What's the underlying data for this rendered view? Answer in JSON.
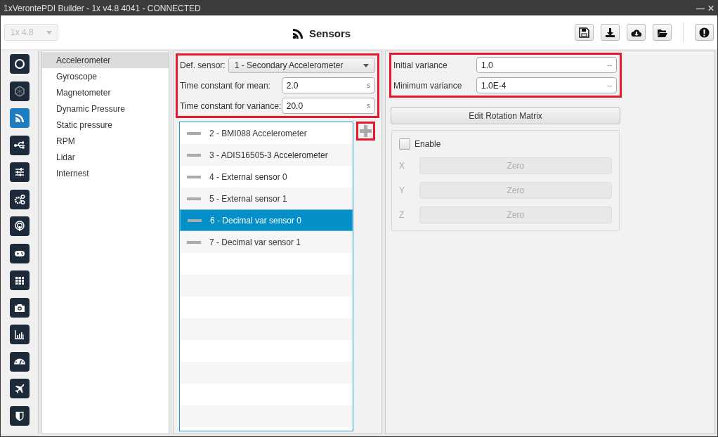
{
  "window": {
    "title": "1xVerontePDI Builder - 1x v4.8 4041 - CONNECTED",
    "controls": [
      "—",
      "✕"
    ]
  },
  "header": {
    "version_select": "1x 4.8",
    "title": "Sensors",
    "toolbar": [
      {
        "kind": "save"
      },
      {
        "kind": "download"
      },
      {
        "kind": "cloud"
      },
      {
        "kind": "folder"
      },
      {
        "kind": "alert"
      }
    ]
  },
  "rail": [
    {
      "selected": false
    },
    {
      "selected": false
    },
    {
      "selected": true
    },
    {
      "selected": false
    },
    {
      "selected": false
    },
    {
      "selected": false
    },
    {
      "selected": false
    },
    {
      "selected": false
    },
    {
      "selected": false
    },
    {
      "selected": false
    },
    {
      "selected": false
    },
    {
      "selected": false
    },
    {
      "selected": false
    },
    {
      "selected": false
    }
  ],
  "menu": [
    {
      "label": "Accelerometer",
      "selected": true
    },
    {
      "label": "Gyroscope",
      "selected": false
    },
    {
      "label": "Magnetometer",
      "selected": false
    },
    {
      "label": "Dynamic Pressure",
      "selected": false
    },
    {
      "label": "Static pressure",
      "selected": false
    },
    {
      "label": "RPM",
      "selected": false
    },
    {
      "label": "Lidar",
      "selected": false
    },
    {
      "label": "Internest",
      "selected": false
    }
  ],
  "settings": {
    "def_sensor": {
      "label": "Def. sensor:",
      "value": "1 - Secondary Accelerometer"
    },
    "fields": [
      {
        "label": "Time constant for mean:",
        "value": "2.0",
        "unit": "s"
      },
      {
        "label": "Time constant for variance:",
        "value": "20.0",
        "unit": "s"
      }
    ]
  },
  "sensors": [
    {
      "label": "2 - BMI088 Accelerometer",
      "selected": false
    },
    {
      "label": "3 - ADIS16505-3 Accelerometer",
      "selected": false
    },
    {
      "label": "4 - External sensor 0",
      "selected": false
    },
    {
      "label": "5 - External sensor 1",
      "selected": false
    },
    {
      "label": "6 - Decimal var sensor 0",
      "selected": true
    },
    {
      "label": "7 - Decimal var sensor 1",
      "selected": false
    }
  ],
  "variance": [
    {
      "label": "Initial variance",
      "value": "1.0",
      "unit": "--"
    },
    {
      "label": "Minimum variance",
      "value": "1.0E-4",
      "unit": "--"
    }
  ],
  "rotation": {
    "button": "Edit Rotation Matrix",
    "enable": {
      "label": "Enable",
      "checked": false
    },
    "axes": [
      {
        "label": "X",
        "button": "Zero"
      },
      {
        "label": "Y",
        "button": "Zero"
      },
      {
        "label": "Z",
        "button": "Zero"
      }
    ]
  }
}
